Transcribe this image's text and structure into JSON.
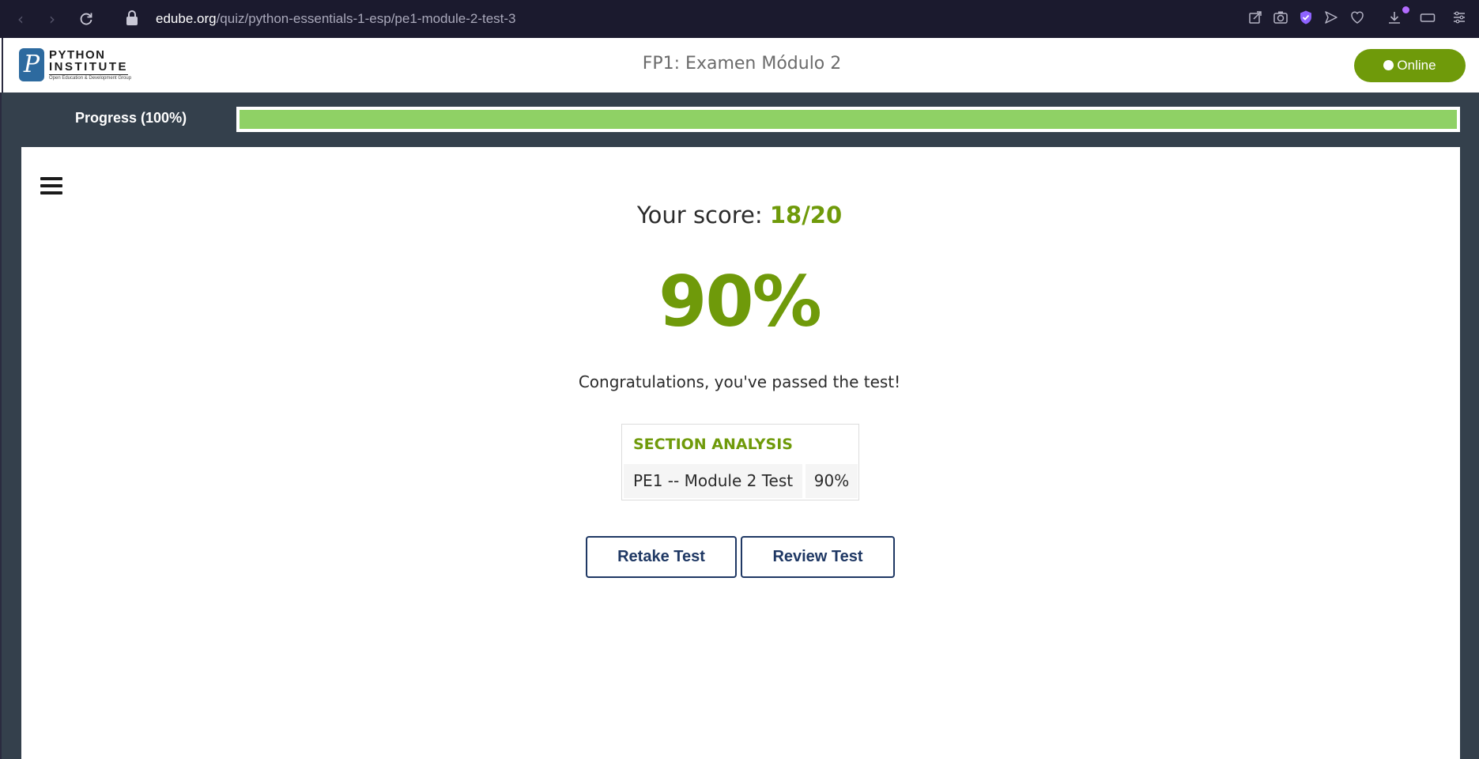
{
  "browser": {
    "url_domain": "edube.org",
    "url_path": "/quiz/python-essentials-1-esp/pe1-module-2-test-3",
    "icons": [
      "back-icon",
      "forward-icon",
      "reload-icon",
      "lock-icon",
      "share-icon",
      "camera-icon",
      "shield-icon",
      "send-icon",
      "heart-icon",
      "download-icon",
      "battery-icon",
      "settings-icon"
    ]
  },
  "header": {
    "logo_line1": "PYTHON",
    "logo_line2": "INSTITUTE",
    "logo_tagline": "Open Education & Development Group",
    "title": "FP1: Examen Módulo 2",
    "status_label": "Online"
  },
  "progress": {
    "label": "Progress (100%)",
    "value": 1.0
  },
  "result": {
    "score_prefix": "Your score: ",
    "score_value": "18/20",
    "percent": "90%",
    "message": "Congratulations, you've passed the test!"
  },
  "section_analysis": {
    "heading": "SECTION ANALYSIS",
    "rows": [
      {
        "name": "PE1 -- Module 2 Test",
        "value": "90%"
      }
    ]
  },
  "actions": {
    "retake_label": "Retake Test",
    "review_label": "Review Test"
  },
  "colors": {
    "accent_green": "#6f9a0a",
    "progress_fill": "#8fd165",
    "button_navy": "#1f3864",
    "page_bg": "#34404c"
  }
}
